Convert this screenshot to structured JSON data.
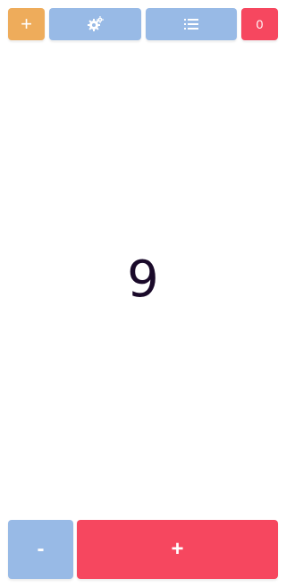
{
  "header": {
    "add_label": "+",
    "reset_count": "0",
    "settings_icon": "settings-gears-icon",
    "list_icon": "list-icon"
  },
  "counter": {
    "value": "9"
  },
  "controls": {
    "decrement_label": "-",
    "increment_label": "+"
  },
  "colors": {
    "orange": "#eeac5b",
    "blue": "#98bae6",
    "red": "#f6475f",
    "text_dark": "#1a0a2a"
  }
}
